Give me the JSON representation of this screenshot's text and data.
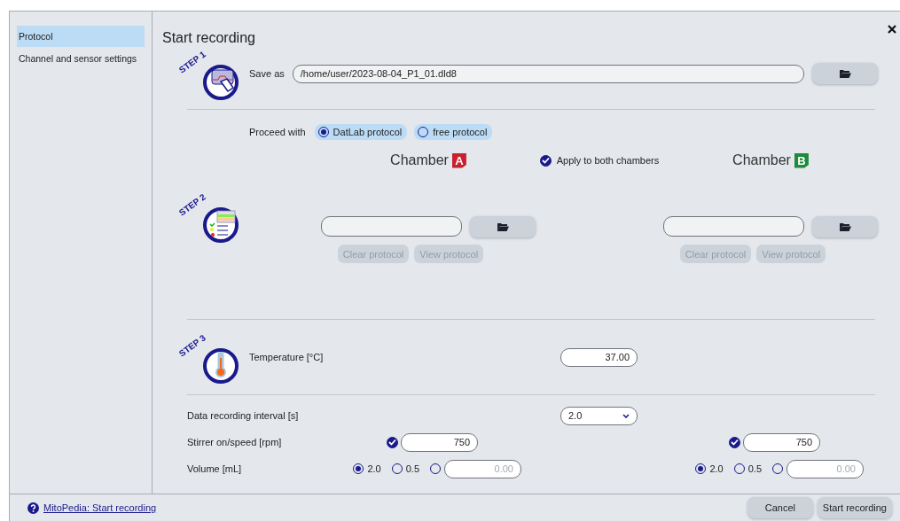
{
  "sidebar": {
    "items": [
      {
        "label": "Protocol",
        "selected": true
      },
      {
        "label": "Channel and sensor settings",
        "selected": false
      }
    ]
  },
  "title": "Start recording",
  "step1": {
    "badge": "STEP 1",
    "save_as_label": "Save as",
    "path": "/home/user/2023-08-04_P1_01.dld8"
  },
  "proceed": {
    "label": "Proceed with",
    "options": [
      {
        "label": "DatLab protocol",
        "selected": true
      },
      {
        "label": "free protocol",
        "selected": false
      }
    ]
  },
  "apply_both": {
    "label": "Apply to both chambers",
    "checked": true
  },
  "step2": {
    "badge": "STEP 2"
  },
  "step3": {
    "badge": "STEP 3",
    "temperature_label": "Temperature [°C]",
    "temperature": "37.00"
  },
  "interval": {
    "label": "Data recording interval [s]",
    "value": "2.0"
  },
  "stirrer_label": "Stirrer on/speed [rpm]",
  "volume_label": "Volume [mL]",
  "chambers": [
    {
      "title": "Chamber",
      "letter": "A",
      "color": "#c8202e",
      "clear_label": "Clear protocol",
      "view_label": "View protocol",
      "disabled": true,
      "stirrer": {
        "checked": true,
        "value": "750"
      },
      "volume_options": [
        {
          "kind": "preset",
          "label": "2.0",
          "selected": true
        },
        {
          "kind": "preset",
          "label": "0.5",
          "selected": false
        },
        {
          "kind": "custom",
          "placeholder": "0.00",
          "selected": false
        }
      ]
    },
    {
      "title": "Chamber",
      "letter": "B",
      "color": "#1e8a3c",
      "clear_label": "Clear protocol",
      "view_label": "View protocol",
      "disabled": true,
      "stirrer": {
        "checked": true,
        "value": "750"
      },
      "volume_options": [
        {
          "kind": "preset",
          "label": "2.0",
          "selected": true
        },
        {
          "kind": "preset",
          "label": "0.5",
          "selected": false
        },
        {
          "kind": "custom",
          "placeholder": "0.00",
          "selected": false
        }
      ]
    }
  ],
  "footer": {
    "help_link": "MitoPedia: Start recording",
    "buttons": [
      "Cancel",
      "Start recording"
    ]
  }
}
